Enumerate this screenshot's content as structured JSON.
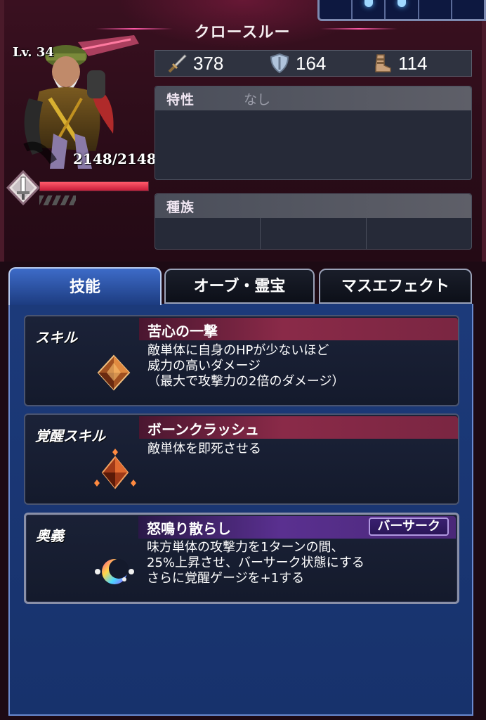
{
  "character": {
    "name": "クロースルー",
    "level": "Lv. 34",
    "hp": "2148/2148",
    "hp_fraction": 1.0
  },
  "stats": {
    "attack": "378",
    "defense": "164",
    "speed": "114"
  },
  "trait": {
    "label": "特性",
    "value": "なし"
  },
  "race": {
    "label": "種族",
    "cells": [
      "",
      "",
      ""
    ]
  },
  "top_slots": {
    "lit": [
      false,
      true,
      true,
      false,
      false
    ]
  },
  "tabs": [
    {
      "label": "技能",
      "active": true
    },
    {
      "label": "オーブ・霊宝",
      "active": false
    },
    {
      "label": "マスエフェクト",
      "active": false
    }
  ],
  "skills": [
    {
      "type_label": "スキル",
      "name": "苦心の一撃",
      "description": [
        "敵単体に自身のHPが少ないほど",
        "威力の高いダメージ",
        "（最大で攻撃力の2倍のダメージ）"
      ],
      "icon": "orange-crystal-icon"
    },
    {
      "type_label": "覚醒スキル",
      "name": "ボーンクラッシュ",
      "description": [
        "敵単体を即死させる"
      ],
      "icon": "awakened-crystal-icon"
    },
    {
      "type_label": "奥義",
      "name": "怒鳴り散らし",
      "tag": "バーサーク",
      "description": [
        "味方単体の攻撃力を1ターンの間、",
        "25%上昇させ、バーサーク状態にする",
        "さらに覚醒ゲージを+1する"
      ],
      "icon": "rainbow-moon-icon"
    }
  ]
}
